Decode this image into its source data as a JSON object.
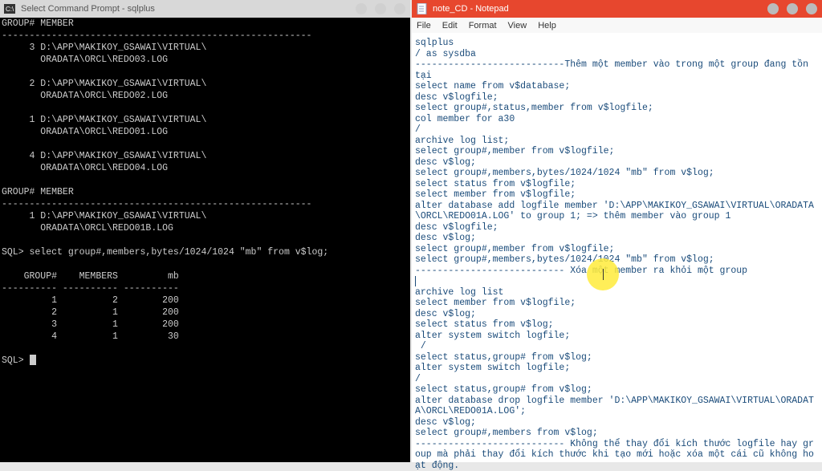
{
  "left": {
    "title": "Select Command Prompt - sqlplus",
    "header": "GROUP# MEMBER",
    "header2": "--------------------------------------------------------",
    "rows1": [
      "     3 D:\\APP\\MAKIKOY_GSAWAI\\VIRTUAL\\",
      "       ORADATA\\ORCL\\REDO03.LOG",
      "",
      "     2 D:\\APP\\MAKIKOY_GSAWAI\\VIRTUAL\\",
      "       ORADATA\\ORCL\\REDO02.LOG",
      "",
      "     1 D:\\APP\\MAKIKOY_GSAWAI\\VIRTUAL\\",
      "       ORADATA\\ORCL\\REDO01.LOG",
      "",
      "     4 D:\\APP\\MAKIKOY_GSAWAI\\VIRTUAL\\",
      "       ORADATA\\ORCL\\REDO04.LOG",
      "",
      "GROUP# MEMBER",
      "--------------------------------------------------------",
      "     1 D:\\APP\\MAKIKOY_GSAWAI\\VIRTUAL\\",
      "       ORADATA\\ORCL\\REDO01B.LOG",
      ""
    ],
    "query": "SQL> select group#,members,bytes/1024/1024 \"mb\" from v$log;",
    "table_hdr": "    GROUP#    MEMBERS         mb",
    "table_sep": "---------- ---------- ----------",
    "table_rows": [
      "         1          2        200",
      "         2          1        200",
      "         3          1        200",
      "         4          1         30"
    ],
    "prompt": "SQL> "
  },
  "right": {
    "title": "note_CD - Notepad",
    "menu": {
      "file": "File",
      "edit": "Edit",
      "format": "Format",
      "view": "View",
      "help": "Help"
    },
    "lines1": "sqlplus\n/ as sysdba\n---------------------------Thêm một member vào trong một group đang tồn tại\nselect name from v$database;\ndesc v$logfile;\nselect group#,status,member from v$logfile;\ncol member for a30\n/\narchive log list;\nselect group#,member from v$logfile;\ndesc v$log;\nselect group#,members,bytes/1024/1024 \"mb\" from v$log;\nselect status from v$logfile;\nselect member from v$logfile;\nalter database add logfile member 'D:\\APP\\MAKIKOY_GSAWAI\\VIRTUAL\\ORADATA\\ORCL\\REDO01A.LOG' to group 1; => thêm member vào group 1\ndesc v$logfile;\ndesc v$log;\nselect group#,member from v$logfile;\nselect group#,members,bytes/1024/1024 \"mb\" from v$log;\n--------------------------- Xóa một member ra khỏi một group",
    "lines2": "\narchive log list\nselect member from v$logfile;\ndesc v$log;\nselect status from v$log;\nalter system switch logfile;\n /\nselect status,group# from v$log;\nalter system switch logfile;\n/\nselect status,group# from v$log;\nalter database drop logfile member 'D:\\APP\\MAKIKOY_GSAWAI\\VIRTUAL\\ORADATA\\ORCL\\REDO01A.LOG';\ndesc v$log;\nselect group#,members from v$log;\n--------------------------- Không thể thay đổi kích thước logfile hay group mà phải thay đổi kích thước khi tạo mới hoặc xóa một cái cũ không hoạt động."
  }
}
